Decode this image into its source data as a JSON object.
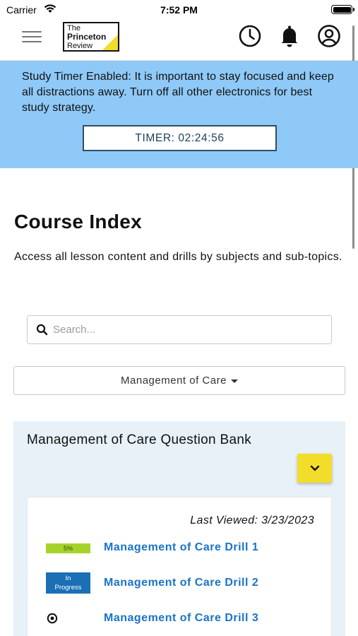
{
  "status_bar": {
    "carrier": "Carrier",
    "time": "7:52 PM"
  },
  "nav": {
    "logo": {
      "line1": "The",
      "line2": "Princeton",
      "line3": "Review"
    },
    "icons": [
      "history-icon",
      "bell-icon",
      "account-icon"
    ]
  },
  "banner": {
    "message": "Study Timer Enabled: It is important to stay focused and keep all distractions away. Turn off all other electronics for best study strategy.",
    "timer": "TIMER: 02:24:56",
    "background": "#8fc9f7"
  },
  "main": {
    "title": "Course Index",
    "description": "Access all lesson content and drills by subjects and sub-topics.",
    "search": {
      "placeholder": "Search...",
      "value": ""
    },
    "dropdown": {
      "selected": "Management of Care"
    }
  },
  "question_bank": {
    "title": "Management of Care Question Bank",
    "last_viewed": "Last Viewed: 3/23/2023",
    "drills": [
      {
        "status": "5%",
        "status_color": "#a6d32a",
        "label": "Management of Care Drill 1"
      },
      {
        "status_line1": "In",
        "status_line2": "Progress",
        "status_color": "#1a6fb5",
        "label": "Management of Care Drill 2"
      },
      {
        "status": "not-started-icon",
        "label": "Management of Care Drill 3"
      }
    ],
    "accent": "#f3dd2b",
    "link_color": "#1a73c6"
  }
}
